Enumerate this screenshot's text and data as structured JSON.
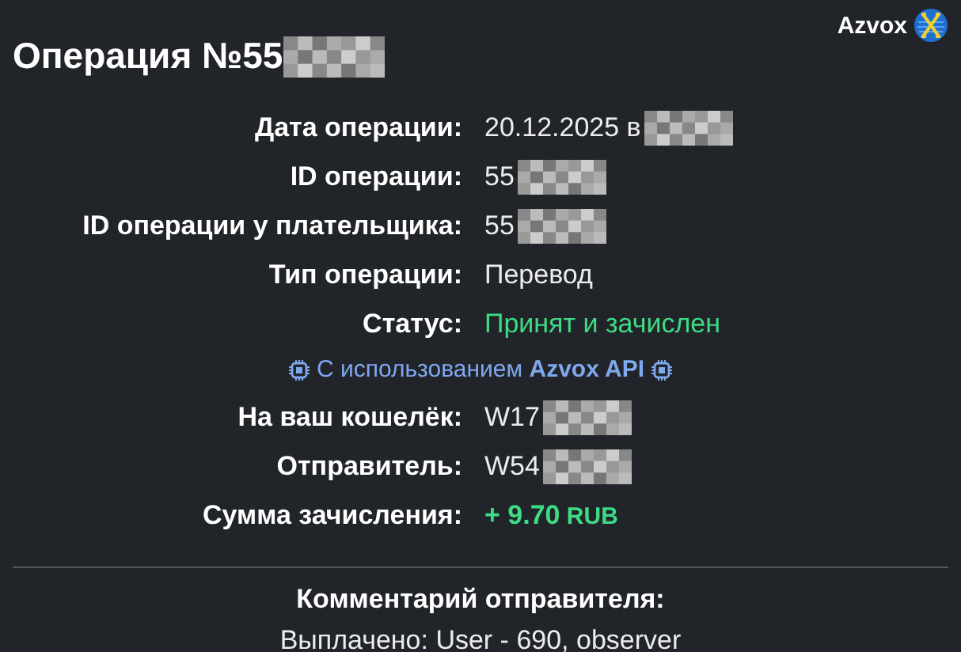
{
  "header": {
    "title": "Операция №55",
    "title_masked": true,
    "brand": "Azvox"
  },
  "details": [
    {
      "kind": "field",
      "label": "Дата операции:",
      "value": "20.12.2025 в",
      "masked": true
    },
    {
      "kind": "field",
      "label": "ID операции:",
      "value": "55",
      "masked": true
    },
    {
      "kind": "field",
      "label": "ID операции у плательщика:",
      "value": "55",
      "masked": true
    },
    {
      "kind": "field",
      "label": "Тип операции:",
      "value": "Перевод",
      "masked": false
    },
    {
      "kind": "status",
      "label": "Статус:",
      "value": "Принят и зачислен",
      "masked": false
    },
    {
      "kind": "note",
      "prefix": "С использованием",
      "brand": "Azvox API"
    },
    {
      "kind": "field",
      "label": "На ваш кошелёк:",
      "value": "W17",
      "masked": true
    },
    {
      "kind": "field",
      "label": "Отправитель:",
      "value": "W54",
      "masked": true
    },
    {
      "kind": "amount",
      "label": "Сумма зачисления:",
      "value": "+ 9.70",
      "currency": "RUB",
      "masked": false
    }
  ],
  "comment": {
    "title": "Комментарий отправителя:",
    "text": "Выплачено: User - 690, observer"
  }
}
